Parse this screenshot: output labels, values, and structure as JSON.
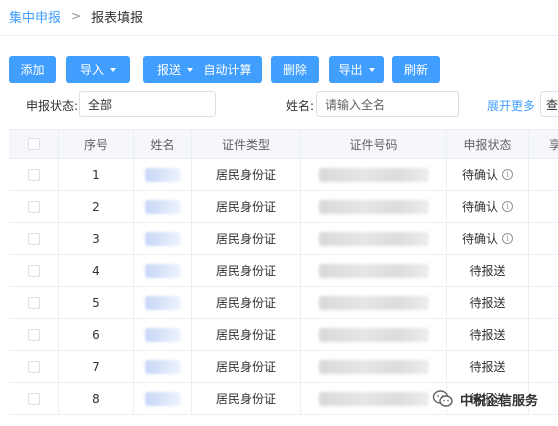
{
  "breadcrumb": {
    "parent": "集中申报",
    "separator": ">",
    "current": "报表填报"
  },
  "toolbar": {
    "add": "添加",
    "import": "导入",
    "send": "报送",
    "auto_calc": "自动计算",
    "delete": "删除",
    "export": "导出",
    "refresh": "刷新"
  },
  "filters": {
    "status_label": "申报状态:",
    "status_value": "全部",
    "name_label": "姓名:",
    "name_placeholder": "请输入全名",
    "expand_more": "展开更多",
    "search_stub": "查"
  },
  "table": {
    "columns": [
      "序号",
      "姓名",
      "证件类型",
      "证件号码",
      "申报状态",
      "享受"
    ],
    "rows": [
      {
        "index": "1",
        "id_type": "居民身份证",
        "status": "待确认",
        "info": true
      },
      {
        "index": "2",
        "id_type": "居民身份证",
        "status": "待确认",
        "info": true
      },
      {
        "index": "3",
        "id_type": "居民身份证",
        "status": "待确认",
        "info": true
      },
      {
        "index": "4",
        "id_type": "居民身份证",
        "status": "待报送",
        "info": false
      },
      {
        "index": "5",
        "id_type": "居民身份证",
        "status": "待报送",
        "info": false
      },
      {
        "index": "6",
        "id_type": "居民身份证",
        "status": "待报送",
        "info": false
      },
      {
        "index": "7",
        "id_type": "居民身份证",
        "status": "待报送",
        "info": false
      },
      {
        "index": "8",
        "id_type": "居民身份证",
        "status": "待报送",
        "info": false
      }
    ]
  },
  "watermark": {
    "text": "中税企信服务"
  },
  "colors": {
    "primary": "#409eff",
    "header_bg": "#f5f7fa",
    "border": "#ebeef5"
  }
}
